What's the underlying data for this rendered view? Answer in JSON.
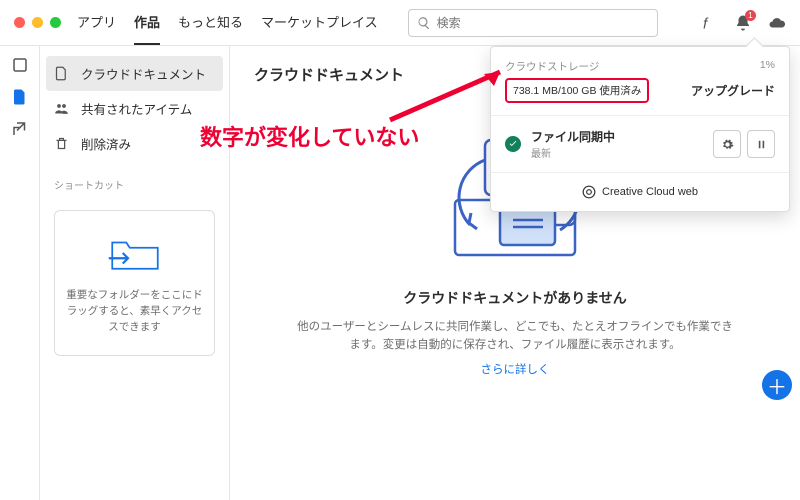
{
  "nav": {
    "apps": "アプリ",
    "works": "作品",
    "know": "もっと知る",
    "market": "マーケットプレイス"
  },
  "search": {
    "placeholder": "検索"
  },
  "notif": {
    "count": "1"
  },
  "sidebar": {
    "cloud": "クラウドドキュメント",
    "shared": "共有されたアイテム",
    "deleted": "削除済み",
    "shortcut_h": "ショートカット",
    "shortcut_txt": "重要なフォルダーをここにドラッグすると、素早くアクセスできます"
  },
  "content": {
    "title": "クラウドドキュメント",
    "empty_h": "クラウドドキュメントがありません",
    "empty_p": "他のユーザーとシームレスに共同作業し、どこでも、たとえオフラインでも作業できます。変更は自動的に保存され、ファイル履歴に表示されます。",
    "more": "さらに詳しく"
  },
  "pop": {
    "storage_h": "クラウドストレージ",
    "percent": "1%",
    "usage": "738.1 MB/100 GB 使用済み",
    "upgrade": "アップグレード",
    "sync_t": "ファイル同期中",
    "sync_s": "最新",
    "ccweb": "Creative Cloud web"
  },
  "anno": "数字が変化していない"
}
